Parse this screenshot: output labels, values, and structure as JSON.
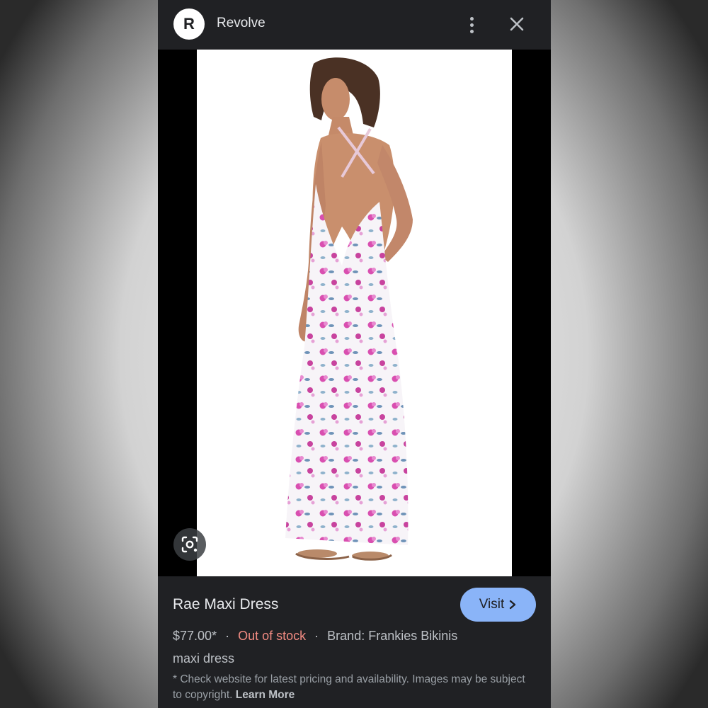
{
  "header": {
    "source_initial": "R",
    "source_name": "Revolve",
    "more_icon": "vertical-dots-icon",
    "close_icon": "close-icon"
  },
  "image": {
    "lens_icon": "lens-search-icon"
  },
  "product": {
    "title": "Rae Maxi Dress",
    "visit_label": "Visit",
    "price": "$77.00*",
    "separator": "·",
    "stock_status": "Out of stock",
    "brand": "Brand: Frankies Bikinis",
    "category": "maxi dress",
    "disclaimer": "* Check website for latest pricing and availability. Images may be subject to copyright.",
    "learn_more": "Learn More"
  },
  "colors": {
    "panel_bg": "#202124",
    "accent": "#8ab4f8",
    "out_of_stock": "#f28b82"
  }
}
